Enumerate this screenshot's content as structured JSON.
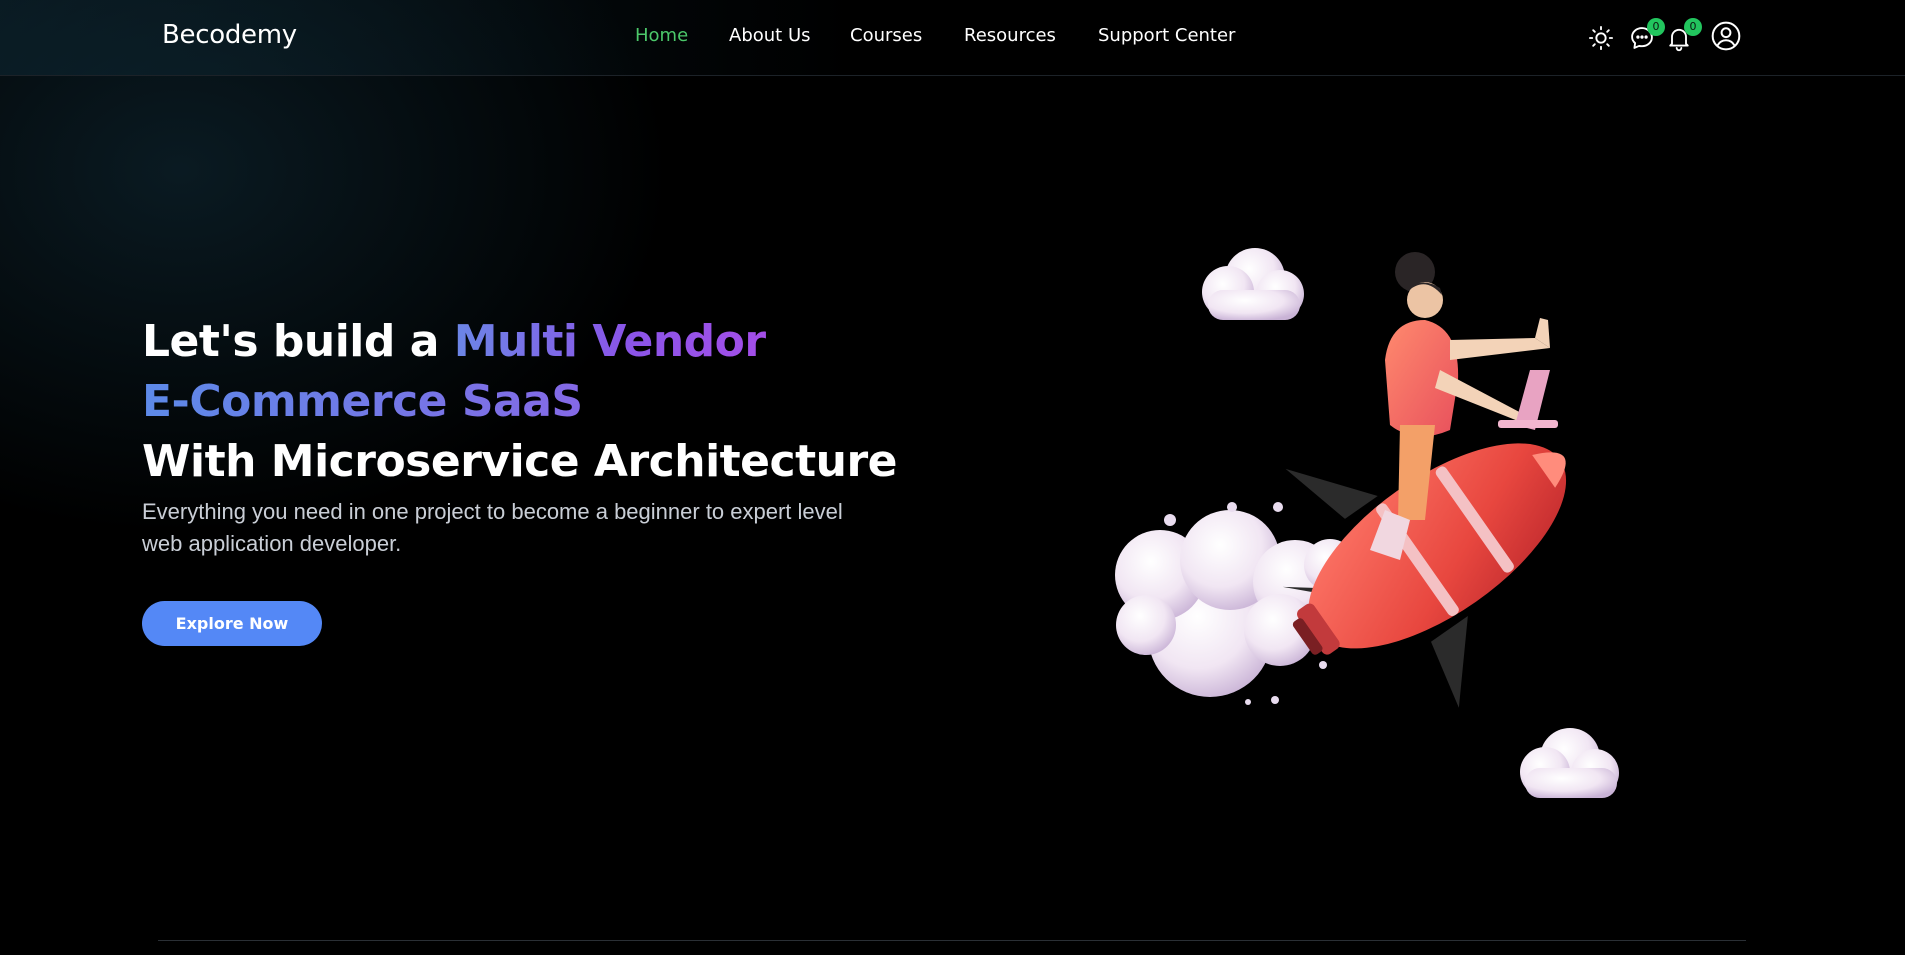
{
  "header": {
    "brand": "Becodemy",
    "nav": [
      {
        "label": "Home",
        "active": true
      },
      {
        "label": "About Us",
        "active": false
      },
      {
        "label": "Courses",
        "active": false
      },
      {
        "label": "Resources",
        "active": false
      },
      {
        "label": "Support Center",
        "active": false
      }
    ],
    "icons": {
      "theme": "sun-icon",
      "messages": "chat-icon",
      "notifications": "bell-icon",
      "account": "user-icon"
    },
    "messages_count": "0",
    "notifications_count": "0"
  },
  "hero": {
    "title_part1": "Let's build a ",
    "title_highlight1": "Multi Vendor",
    "title_highlight2": "E-Commerce SaaS",
    "title_line3": "With Microservice Architecture",
    "subtitle": "Everything you need in one project to become a beginner to expert level web application developer.",
    "cta_label": "Explore Now"
  },
  "colors": {
    "background": "#000000",
    "nav_active": "#4cc86a",
    "cta": "#5488f6",
    "badge": "#22c55e",
    "gradient_start": "#6b86e6",
    "gradient_end": "#a44ee8"
  }
}
